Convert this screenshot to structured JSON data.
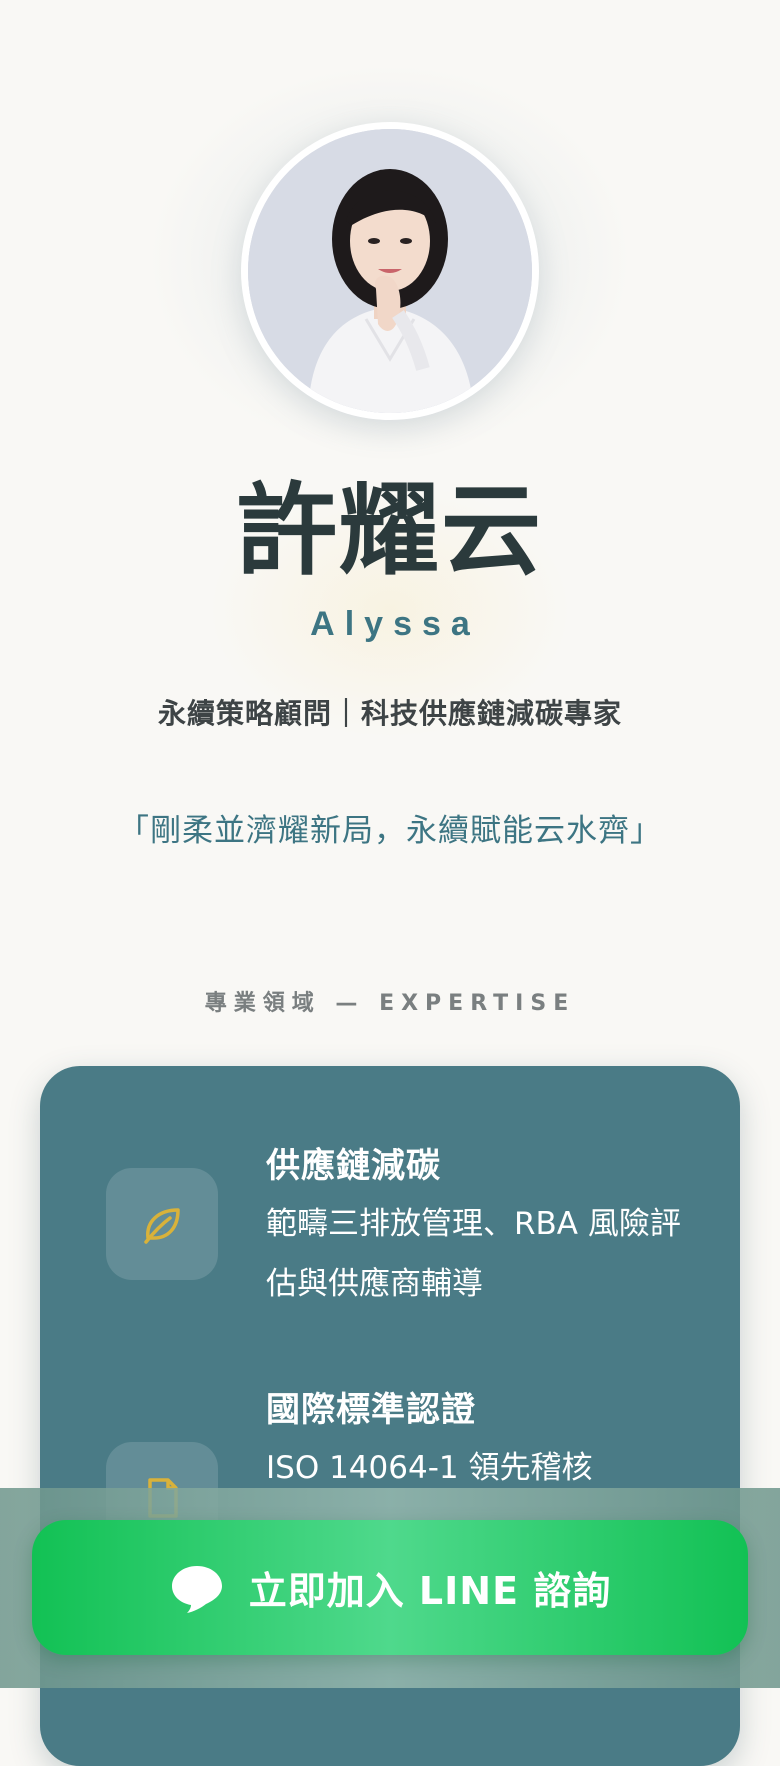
{
  "profile": {
    "name": "許耀云",
    "english_name": "Alyssa",
    "title": "永續策略顧問｜科技供應鏈減碳專家",
    "slogan": "「剛柔並濟耀新局，永續賦能云水齊」"
  },
  "expertise": {
    "section_label": "專業領域 — EXPERTISE",
    "items": [
      {
        "icon": "leaf-icon",
        "title": "供應鏈減碳",
        "description": "範疇三排放管理、RBA 風險評估與供應商輔導"
      },
      {
        "icon": "document-icon",
        "title": "國際標準認證",
        "description": "ISO 14064-1 領先稽核"
      }
    ]
  },
  "cta": {
    "icon": "line-chat-icon",
    "label": "立即加入 LINE 諮詢"
  },
  "colors": {
    "accent_teal": "#3d7583",
    "card_bg": "#4a7b86",
    "line_green": "#12c154",
    "icon_gold": "#d9b23a"
  }
}
